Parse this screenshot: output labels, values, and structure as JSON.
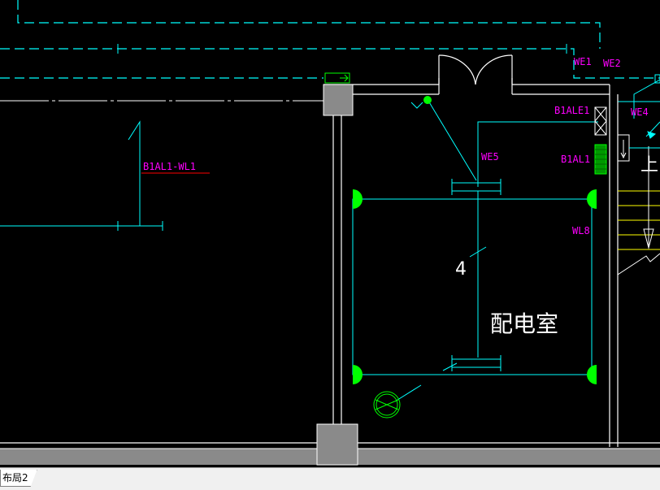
{
  "circuit_labels": {
    "we1": "WE1",
    "we2": "WE2",
    "we4": "WE4",
    "we5": "WE5",
    "wl8": "WL8",
    "b1ale1": "B1ALE1",
    "b1al1": "B1AL1",
    "b1al1_wl1": "B1AL1-WL1"
  },
  "room_name": "配电室",
  "wire_count": "4",
  "stair_label": "上",
  "layout_tab": "布局2",
  "colors": {
    "background": "#000000",
    "cyan": "#00ffff",
    "white": "#ffffff",
    "magenta": "#ff00ff",
    "green": "#00ff00",
    "red": "#ff0000",
    "yellow": "#ffff00",
    "gray": "#808080"
  }
}
